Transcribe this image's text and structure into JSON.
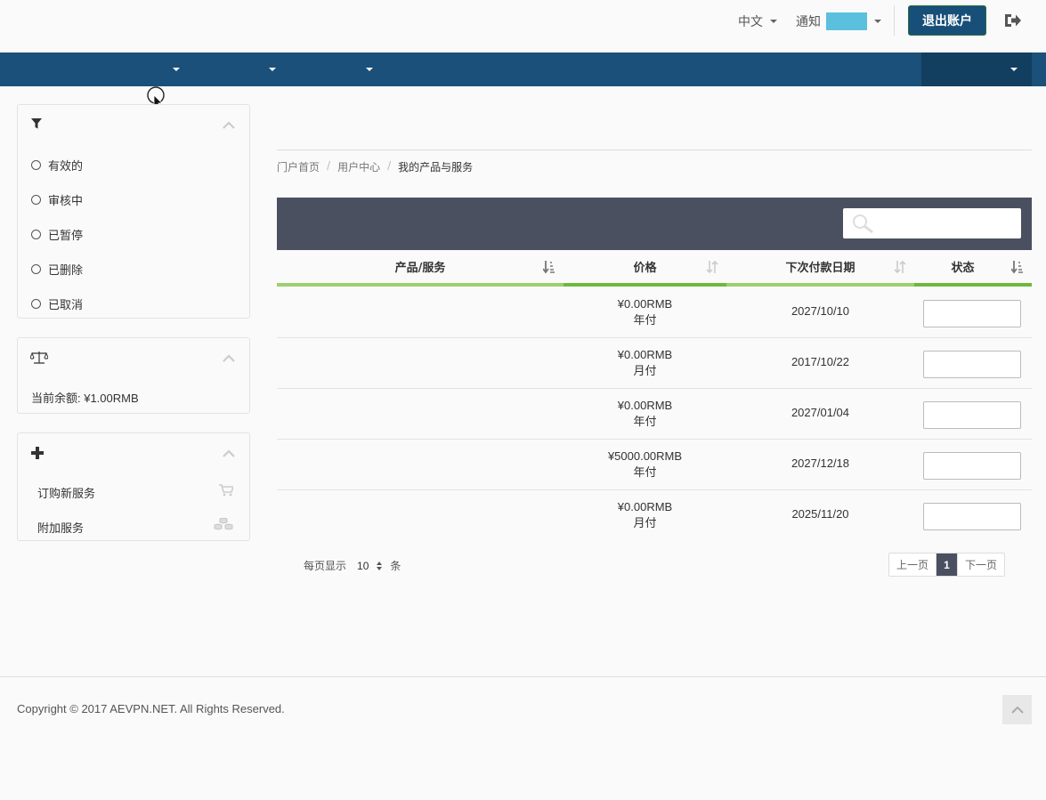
{
  "header": {
    "language_label": "中文",
    "notifications_label": "通知",
    "logout_label": "退出账户",
    "colors": {
      "brand": "#1a5079",
      "badge": "#5bc0de"
    }
  },
  "sidebar": {
    "filters": [
      {
        "label": "有效的"
      },
      {
        "label": "审核中"
      },
      {
        "label": "已暂停"
      },
      {
        "label": "已删除"
      },
      {
        "label": "已取消"
      }
    ],
    "balance_text": "当前余额: ¥1.00RMB",
    "actions": [
      {
        "label": "订购新服务",
        "icon": "cart-icon"
      },
      {
        "label": "附加服务",
        "icon": "cubes-icon"
      }
    ]
  },
  "breadcrumb": [
    {
      "label": "门户首页"
    },
    {
      "label": "用户中心"
    },
    {
      "label": "我的产品与服务"
    }
  ],
  "table": {
    "headers": {
      "product": "产品/服务",
      "price": "价格",
      "next_due": "下次付款日期",
      "status": "状态"
    },
    "rows": [
      {
        "price": "¥0.00RMB",
        "cycle": "年付",
        "date": "2027/10/10"
      },
      {
        "price": "¥0.00RMB",
        "cycle": "月付",
        "date": "2017/10/22"
      },
      {
        "price": "¥0.00RMB",
        "cycle": "年付",
        "date": "2027/01/04"
      },
      {
        "price": "¥5000.00RMB",
        "cycle": "年付",
        "date": "2027/12/18"
      },
      {
        "price": "¥0.00RMB",
        "cycle": "月付",
        "date": "2025/11/20"
      }
    ]
  },
  "pager": {
    "per_page_label": "每页显示",
    "per_page_value": "10",
    "per_page_unit": "条",
    "prev_label": "上一页",
    "current_page": "1",
    "next_label": "下一页"
  },
  "footer": {
    "copyright": "Copyright © 2017 AEVPN.NET. All Rights Reserved."
  }
}
